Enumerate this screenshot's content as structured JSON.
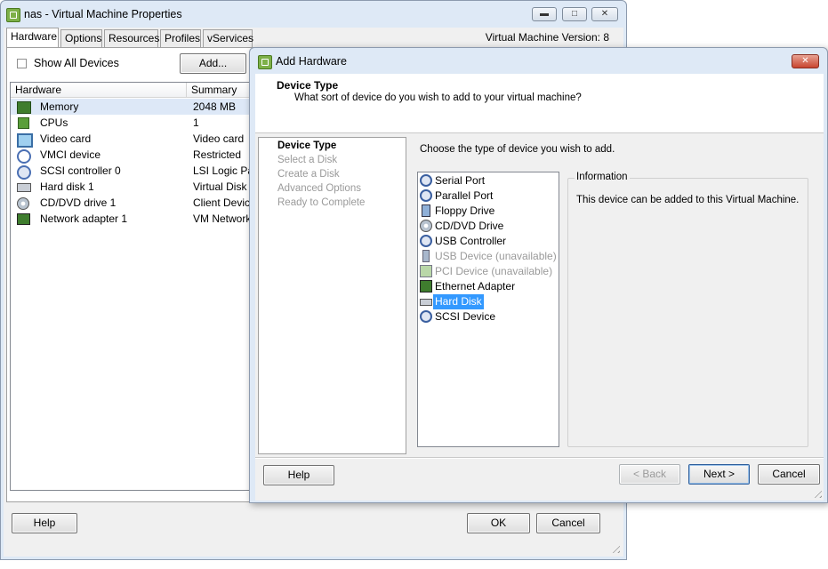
{
  "vm_properties": {
    "title": "nas - Virtual Machine Properties",
    "vm_version": "Virtual Machine Version: 8",
    "tabs": [
      {
        "label": "Hardware",
        "active": true
      },
      {
        "label": "Options"
      },
      {
        "label": "Resources"
      },
      {
        "label": "Profiles"
      },
      {
        "label": "vServices"
      }
    ],
    "show_all_devices_label": "Show All Devices",
    "show_all_devices_checked": false,
    "add_button": "Add...",
    "columns": {
      "hardware": "Hardware",
      "summary": "Summary"
    },
    "hardware_rows": [
      {
        "name": "Memory",
        "summary": "2048 MB",
        "icon": "memory-icon",
        "selected": true
      },
      {
        "name": "CPUs",
        "summary": "1",
        "icon": "cpu-icon"
      },
      {
        "name": "Video card",
        "summary": "Video card",
        "icon": "monitor-icon"
      },
      {
        "name": "VMCI device",
        "summary": "Restricted",
        "icon": "vmci-icon"
      },
      {
        "name": "SCSI controller 0",
        "summary": "LSI Logic Par",
        "icon": "scsi-controller-icon"
      },
      {
        "name": "Hard disk 1",
        "summary": "Virtual Disk",
        "icon": "hard-disk-icon"
      },
      {
        "name": "CD/DVD drive 1",
        "summary": "Client Device",
        "icon": "cd-dvd-icon"
      },
      {
        "name": "Network adapter 1",
        "summary": "VM Network",
        "icon": "network-adapter-icon"
      }
    ],
    "help_button": "Help",
    "ok_button": "OK",
    "cancel_button": "Cancel"
  },
  "add_hardware": {
    "title": "Add Hardware",
    "header_title": "Device Type",
    "header_subtitle": "What sort of device do you wish to add to your virtual machine?",
    "steps": [
      {
        "label": "Device Type",
        "current": true
      },
      {
        "label": "Select a Disk"
      },
      {
        "label": "Create a Disk"
      },
      {
        "label": "Advanced Options"
      },
      {
        "label": "Ready to Complete"
      }
    ],
    "instruction": "Choose the type of device you wish to add.",
    "devices": [
      {
        "label": "Serial Port",
        "icon": "serial-port-icon"
      },
      {
        "label": "Parallel Port",
        "icon": "parallel-port-icon"
      },
      {
        "label": "Floppy Drive",
        "icon": "floppy-drive-icon"
      },
      {
        "label": "CD/DVD Drive",
        "icon": "cd-dvd-drive-icon"
      },
      {
        "label": "USB Controller",
        "icon": "usb-controller-icon"
      },
      {
        "label": "USB Device (unavailable)",
        "icon": "usb-device-icon",
        "unavailable": true
      },
      {
        "label": "PCI Device (unavailable)",
        "icon": "pci-device-icon",
        "unavailable": true
      },
      {
        "label": "Ethernet Adapter",
        "icon": "ethernet-adapter-icon"
      },
      {
        "label": "Hard Disk",
        "icon": "hard-disk-icon",
        "selected": true
      },
      {
        "label": "SCSI Device",
        "icon": "scsi-device-icon"
      }
    ],
    "information_label": "Information",
    "information_text": "This device can be added to this Virtual Machine.",
    "help_button": "Help",
    "back_button": "< Back",
    "next_button": "Next >",
    "cancel_button": "Cancel"
  },
  "colors": {
    "selection": "#3399ff",
    "title_frame": "#dee9f6",
    "close_button_red": "#c8452f"
  }
}
